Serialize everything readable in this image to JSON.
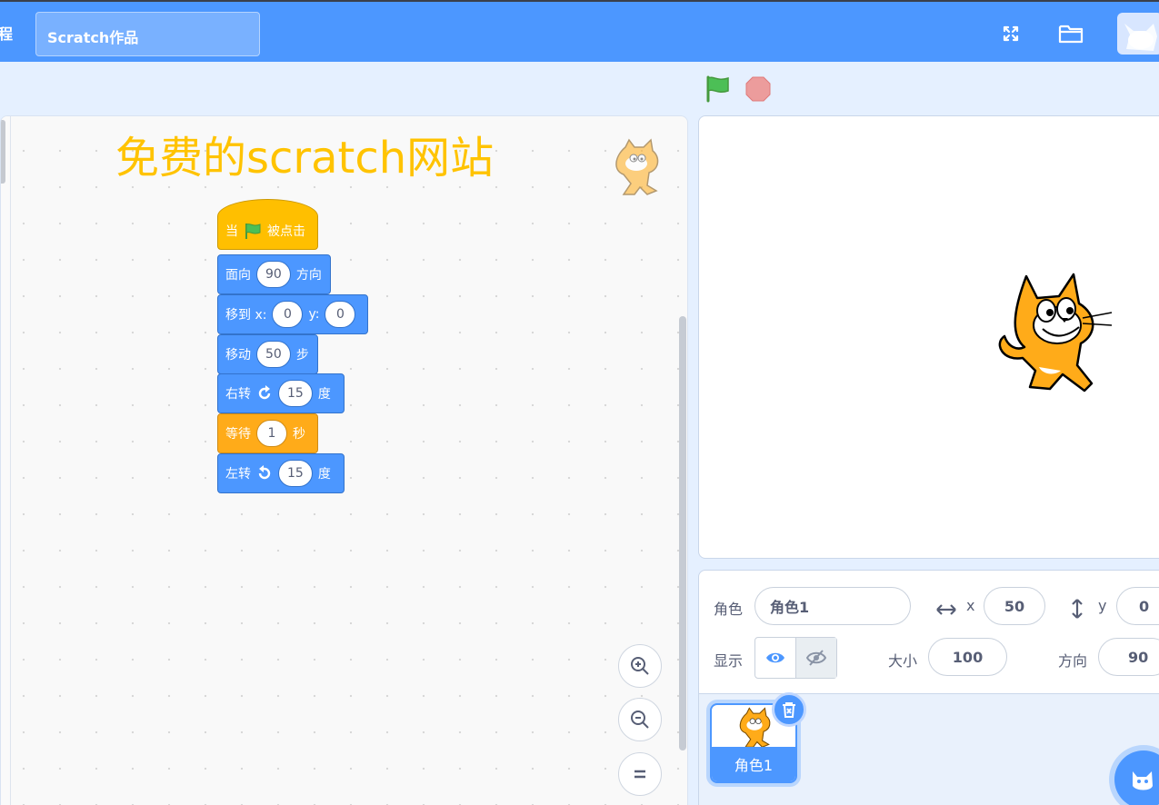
{
  "menubar": {
    "edge_char": "程",
    "project_title": "Scratch作品",
    "fullscreen_icon": "fullscreen-icon",
    "folder_icon": "folder-icon",
    "avatar_icon": "cat-avatar-icon"
  },
  "stage_header": {
    "green_flag_icon": "green-flag-icon",
    "stop_icon": "stop-icon"
  },
  "code_area": {
    "watermark": "免费的scratch网站",
    "blocks": {
      "when": {
        "prefix": "当",
        "suffix": "被点击"
      },
      "point": {
        "prefix": "面向",
        "value": "90",
        "suffix": "方向"
      },
      "goto": {
        "prefix": "移到 x:",
        "x": "0",
        "ylabel": "y:",
        "y": "0"
      },
      "move": {
        "prefix": "移动",
        "value": "50",
        "suffix": "步"
      },
      "turn_right": {
        "prefix": "右转",
        "value": "15",
        "suffix": "度"
      },
      "wait": {
        "prefix": "等待",
        "value": "1",
        "suffix": "秒"
      },
      "turn_left": {
        "prefix": "左转",
        "value": "15",
        "suffix": "度"
      }
    },
    "zoom_in_icon": "zoom-in-icon",
    "zoom_out_icon": "zoom-out-icon",
    "zoom_reset_icon": "zoom-reset-icon"
  },
  "sprite_info": {
    "sprite_label": "角色",
    "sprite_name": "角色1",
    "x_label": "x",
    "x_value": "50",
    "y_label": "y",
    "y_value": "0",
    "show_label": "显示",
    "size_label": "大小",
    "size_value": "100",
    "direction_label": "方向",
    "direction_value": "90"
  },
  "sprite_list": {
    "items": [
      {
        "name": "角色1"
      }
    ]
  },
  "colors": {
    "menubar": "#4c97ff",
    "motion": "#4c97ff",
    "events": "#ffbf00",
    "control": "#ffab19",
    "watermark": "#ffc300"
  }
}
